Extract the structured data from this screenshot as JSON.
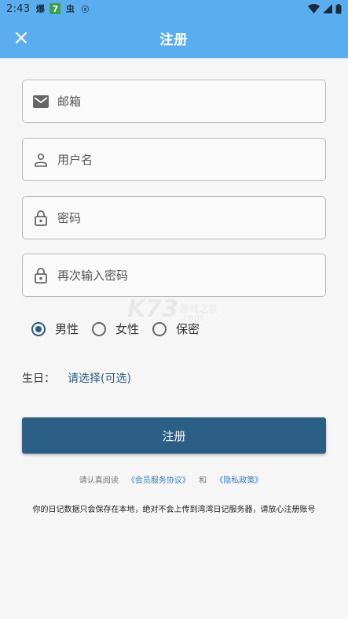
{
  "status_bar": {
    "time": "2:43",
    "notif_icons": [
      "爆",
      "7",
      "虫",
      "ⓢ"
    ]
  },
  "app_bar": {
    "title": "注册",
    "close_icon": "close-icon"
  },
  "form": {
    "email": {
      "placeholder": "邮箱",
      "icon": "mail-icon"
    },
    "username": {
      "placeholder": "用户名",
      "icon": "person-icon"
    },
    "password": {
      "placeholder": "密码",
      "icon": "lock-icon"
    },
    "password_confirm": {
      "placeholder": "再次输入密码",
      "icon": "lock-icon"
    },
    "gender": {
      "options": [
        "男性",
        "女性",
        "保密"
      ],
      "selected": "男性"
    },
    "birthday": {
      "label": "生日：",
      "value": "请选择(可选)"
    },
    "submit_label": "注册"
  },
  "agreement": {
    "prefix": "请认真阅读",
    "terms": "《会员服务协议》",
    "and": "和",
    "privacy": "《隐私政策》"
  },
  "note": "你的日记数据只会保存在本地，绝对不会上传到湾湾日记服务器，请放心注册账号",
  "watermark": {
    "mark": "K73",
    "line1": "游戏之家",
    "line2": ".com"
  },
  "colors": {
    "app_bar": "#5aaef0",
    "primary": "#2c5f86",
    "link": "#3a7bc0"
  }
}
